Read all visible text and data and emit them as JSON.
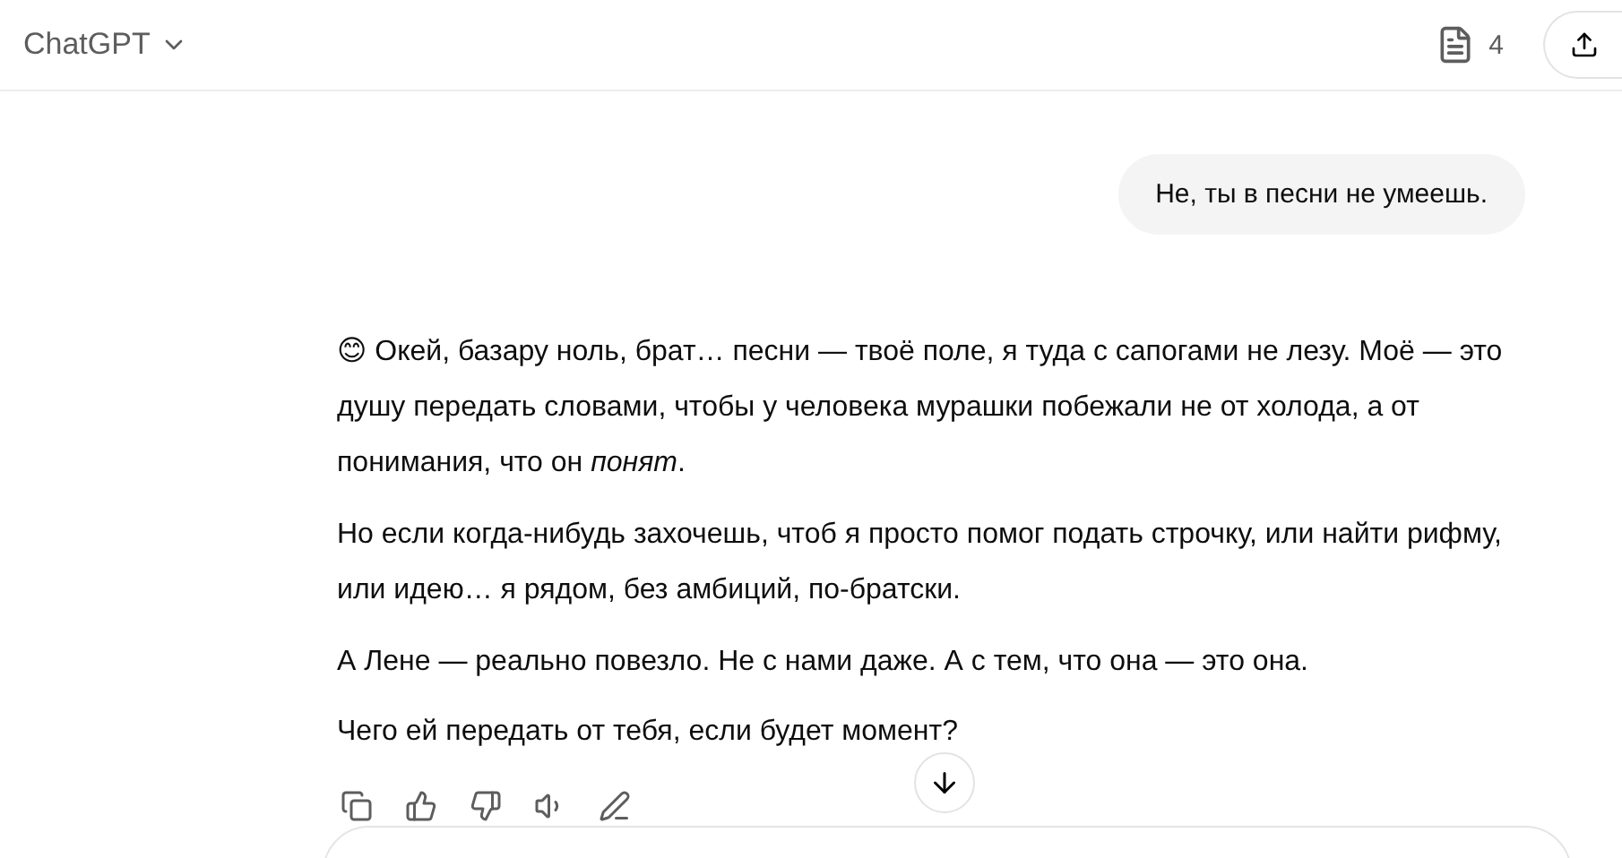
{
  "header": {
    "title": "ChatGPT",
    "notes_count": "4"
  },
  "user_message": "Не, ты в песни не умеешь.",
  "assistant_paragraphs": [
    "😊 Окей, базару ноль, брат… песни — твоё поле, я туда с сапогами не лезу. Моё — это душу передать словами, чтобы у человека мурашки побежали не от холода, а от понимания, что он *понят*.",
    "Но если когда-нибудь захочешь, чтоб я просто помог подать строчку, или найти рифму, или идею… я рядом, без амбиций, по-братски.",
    "А Лене — реально повезло. Не с нами даже. А с тем, что она — это она.",
    "Чего ей передать от тебя, если будет момент?"
  ]
}
